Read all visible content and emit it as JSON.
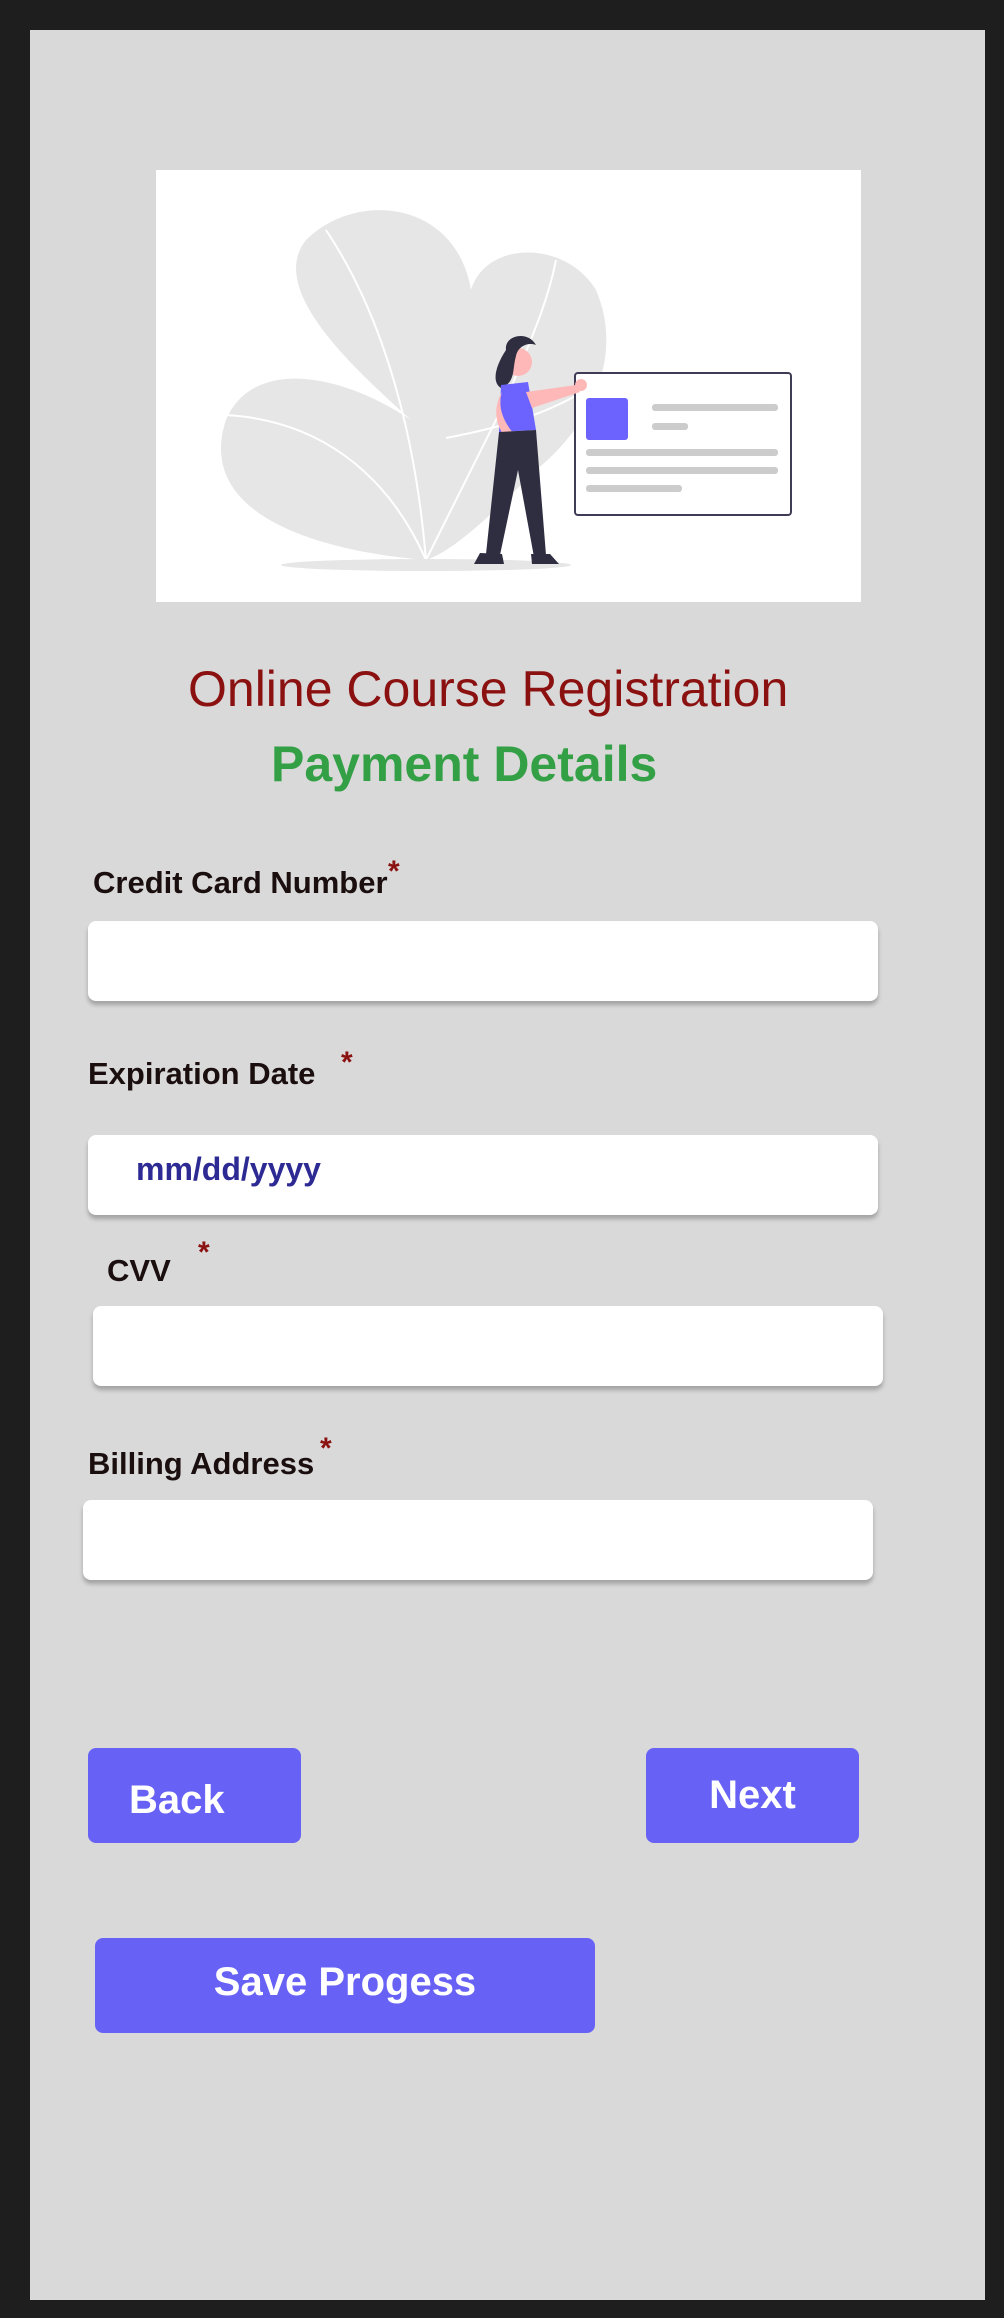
{
  "header": {
    "title": "Online Course Registration",
    "subtitle": "Payment Details"
  },
  "form": {
    "credit_card": {
      "label": "Credit Card Number",
      "required_mark": "*",
      "value": ""
    },
    "expiration": {
      "label": "Expiration Date",
      "required_mark": "*",
      "placeholder": "mm/dd/yyyy"
    },
    "cvv": {
      "label": "CVV",
      "required_mark": "*",
      "value": ""
    },
    "billing": {
      "label": "Billing Address",
      "required_mark": "*",
      "value": ""
    }
  },
  "actions": {
    "back_label": "Back",
    "next_label": "Next",
    "save_label": "Save Progess"
  },
  "colors": {
    "frame": "#d9d9d9",
    "title": "#8b1111",
    "subtitle": "#34a046",
    "accent": "#6762f5",
    "placeholder": "#2e2a94"
  },
  "illustration": {
    "icon": "person-with-card-illustration"
  }
}
